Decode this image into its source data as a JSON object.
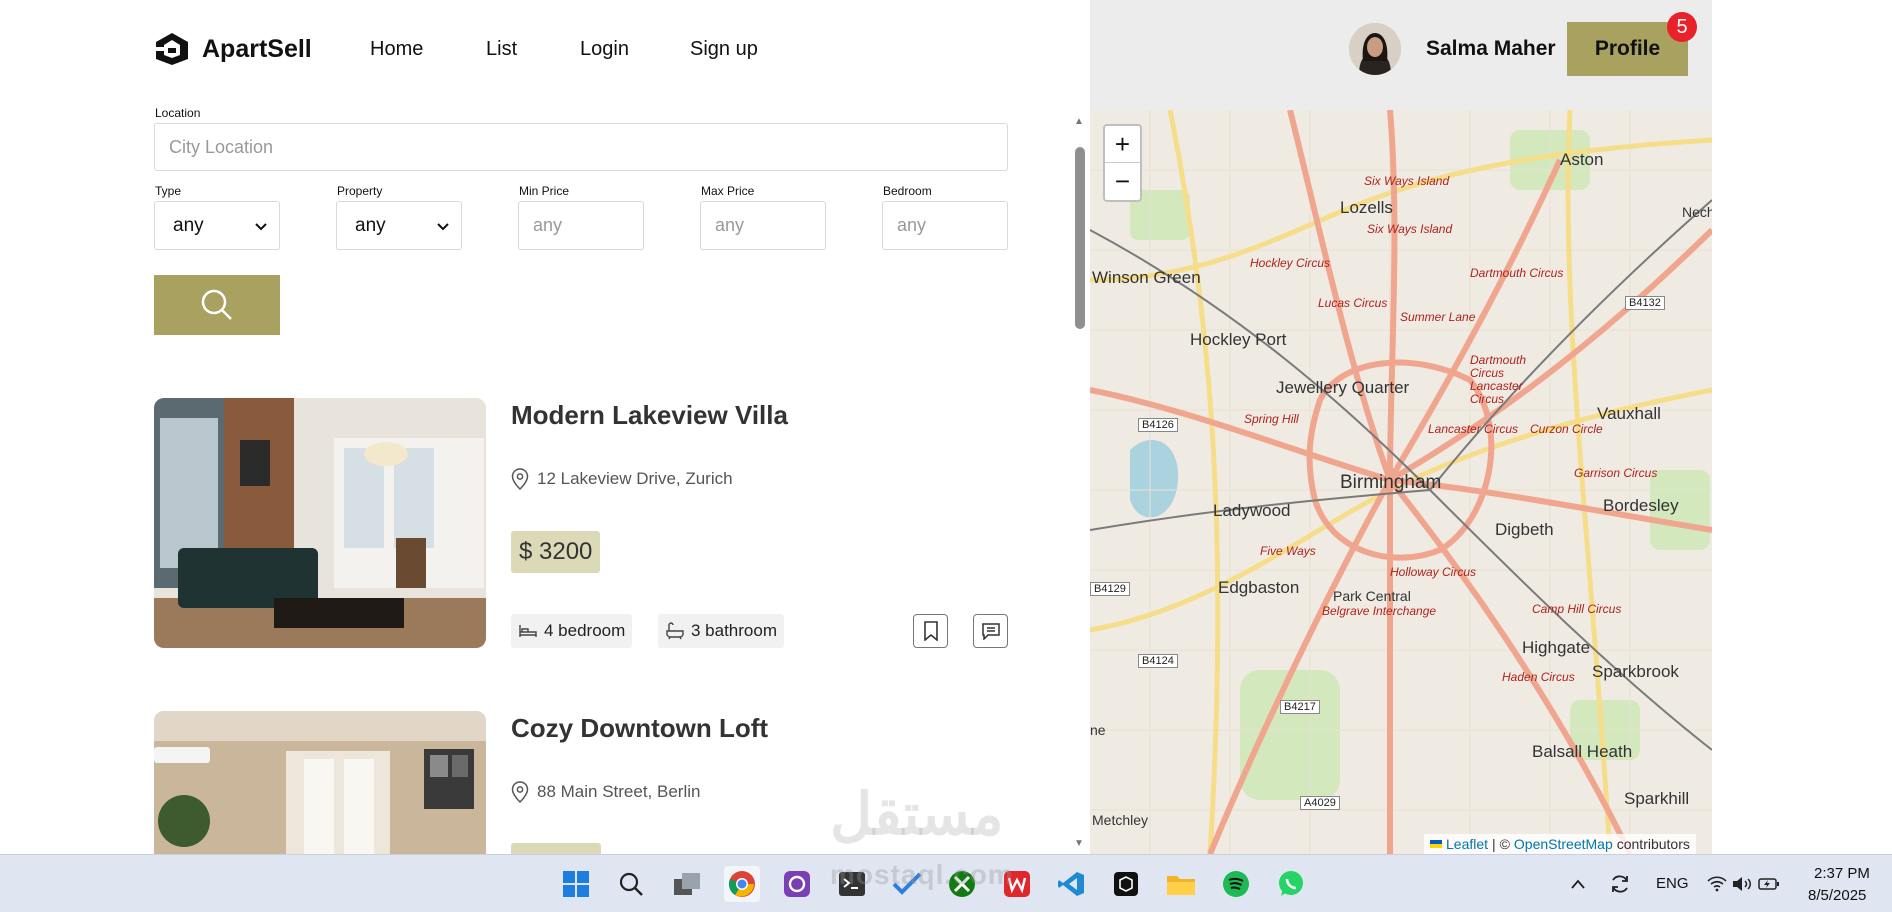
{
  "app": {
    "name": "ApartSell"
  },
  "nav": {
    "items": [
      "Home",
      "List",
      "Login",
      "Sign up"
    ]
  },
  "user": {
    "name": "Salma Maher",
    "profile_label": "Profile",
    "notifications": "5"
  },
  "filters": {
    "location_label": "Location",
    "location_placeholder": "City Location",
    "type_label": "Type",
    "type_value": "any",
    "property_label": "Property",
    "property_value": "any",
    "min_price_label": "Min Price",
    "min_price_placeholder": "any",
    "max_price_label": "Max Price",
    "max_price_placeholder": "any",
    "bedroom_label": "Bedroom",
    "bedroom_placeholder": "any"
  },
  "listings": [
    {
      "title": "Modern Lakeview Villa",
      "address": "12 Lakeview Drive, Zurich",
      "price": "$ 3200",
      "bedrooms": "4 bedroom",
      "bathrooms": "3 bathroom"
    },
    {
      "title": "Cozy Downtown Loft",
      "address": "88 Main Street, Berlin"
    }
  ],
  "map": {
    "zoom_in": "+",
    "zoom_out": "−",
    "attribution_leaflet": "Leaflet",
    "attribution_sep": "| ©",
    "attribution_osm": "OpenStreetMap",
    "attribution_tail": "contributors",
    "labels": [
      "Aston",
      "Lozells",
      "Winson Green",
      "Hockley Port",
      "Jewellery Quarter",
      "Vauxhall",
      "Birmingham",
      "Ladywood",
      "Digbeth",
      "Bordesley",
      "Edgbaston",
      "Park Central",
      "Highgate",
      "Sparkbrook",
      "Balsall Heath",
      "Sparkhill",
      "Metchley",
      "Nech",
      "ne"
    ],
    "circuses": [
      "Six Ways Island",
      "Six Ways Island",
      "Hockley Circus",
      "Dartmouth Circus",
      "Lucas Circus",
      "Summer Lane",
      "Dartmouth Circus Lancaster Circus",
      "Spring Hill",
      "Lancaster Circus",
      "Curzon Circle",
      "Garrison Circus",
      "Five Ways",
      "Holloway Circus",
      "Belgrave Interchange",
      "Camp Hill Circus",
      "Haden Circus"
    ],
    "roads": [
      "B4132",
      "B4126",
      "B4129",
      "B4124",
      "B4217",
      "A4029"
    ]
  },
  "watermark": {
    "arabic": "مستقل",
    "latin": "mostaql.com"
  },
  "taskbar": {
    "lang": "ENG",
    "time": "2:37 PM",
    "date": "8/5/2025"
  }
}
